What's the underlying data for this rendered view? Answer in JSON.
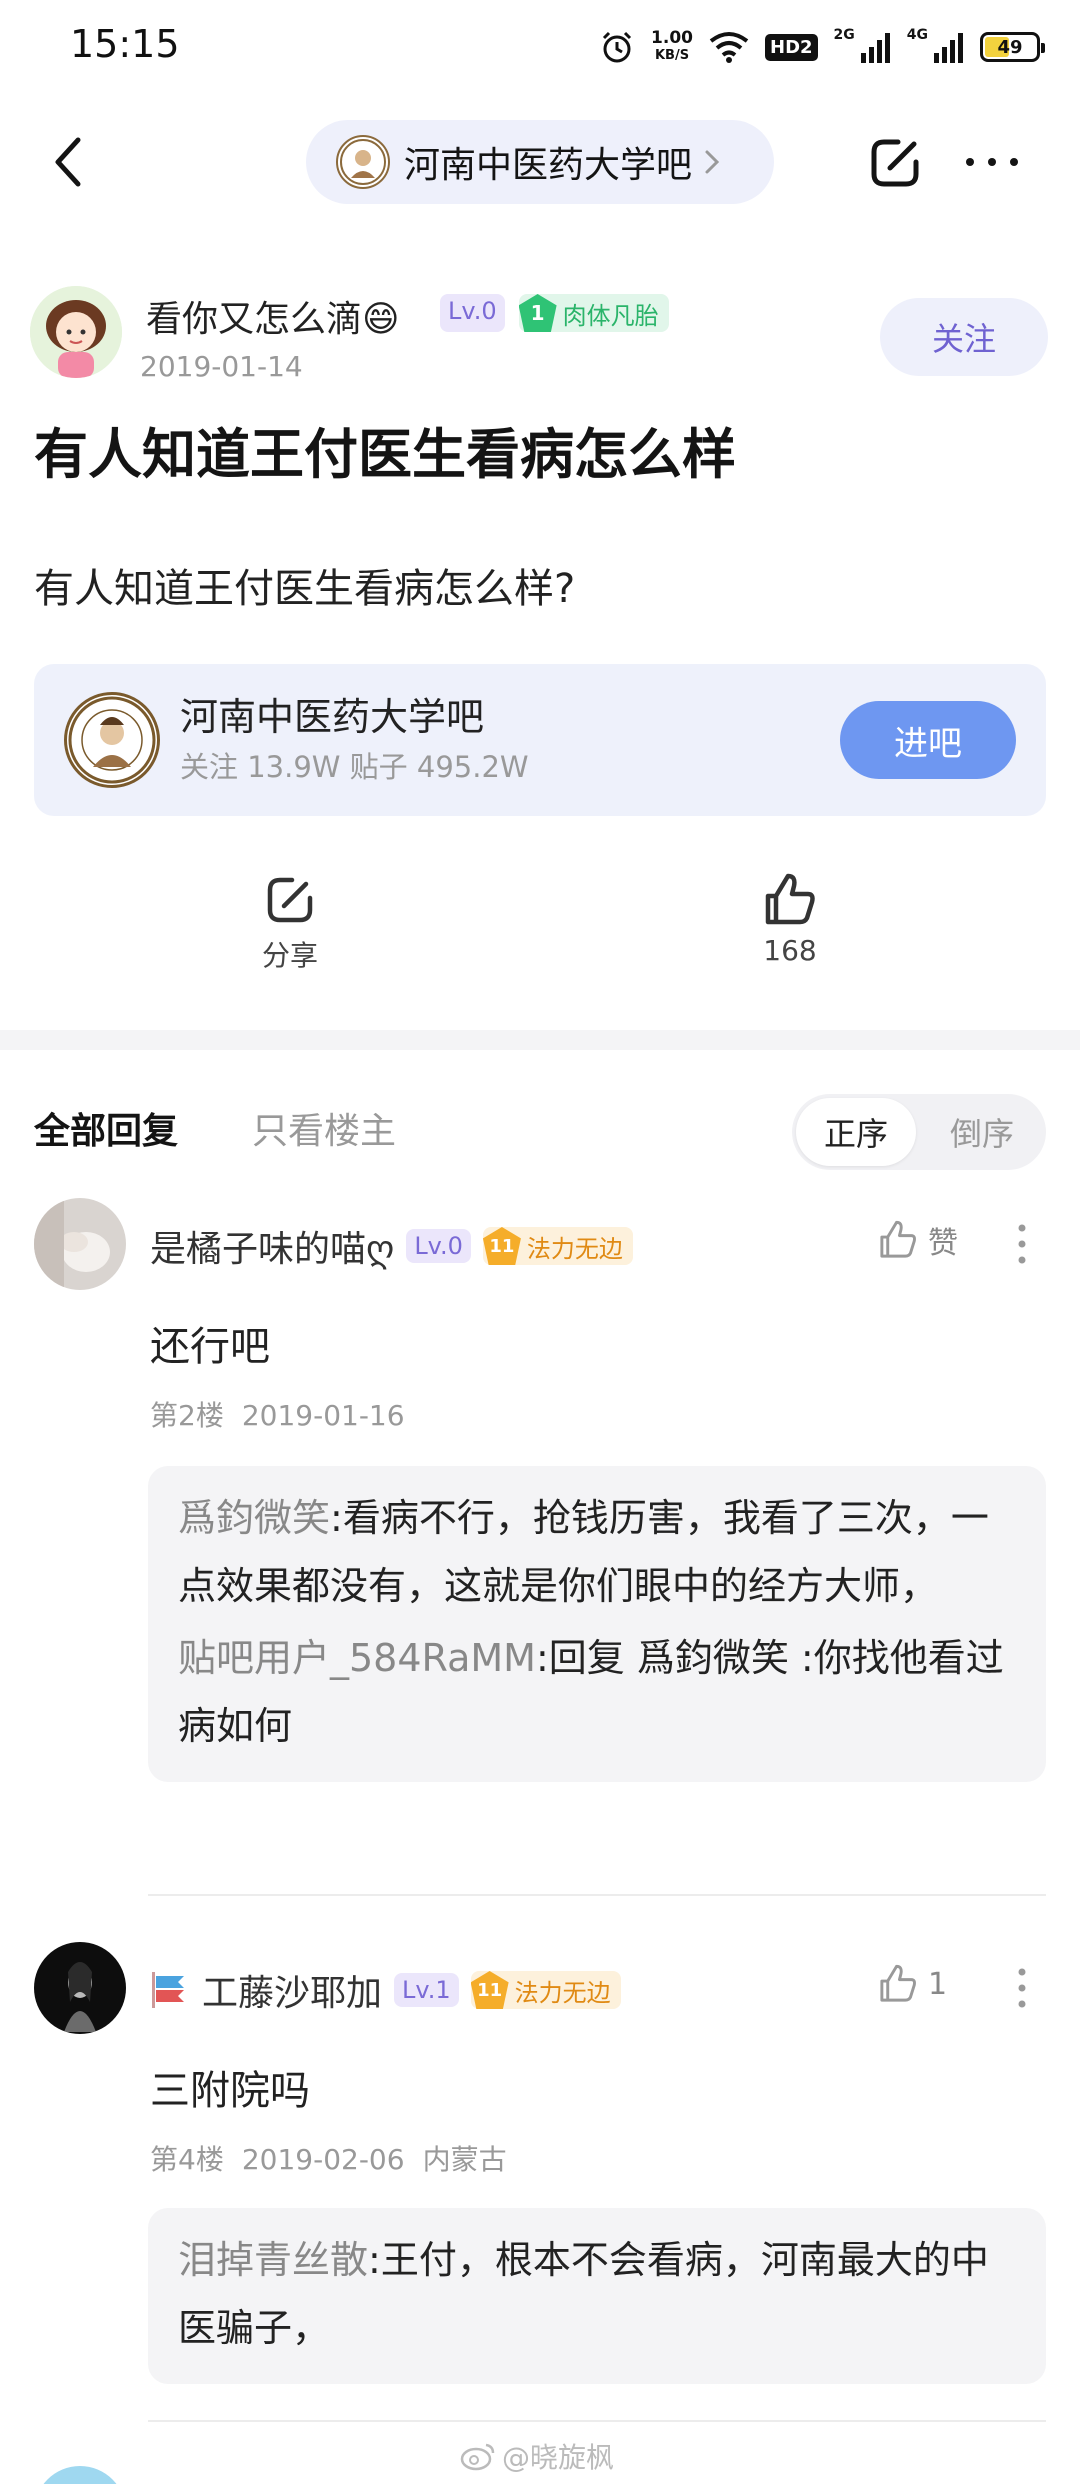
{
  "status_bar": {
    "time": "15:15",
    "net_speed_value": "1.00",
    "net_speed_unit": "KB/S",
    "hd_label": "HD2",
    "signal_1_label": "2G",
    "signal_2_label": "4G",
    "battery": "49"
  },
  "nav": {
    "forum_name": "河南中医药大学吧"
  },
  "post": {
    "author": "看你又怎么滴😄",
    "level": "Lv.0",
    "badge_level": "1",
    "badge_title": "肉体凡胎",
    "date": "2019-01-14",
    "follow_label": "关注",
    "title": "有人知道王付医生看病怎么样",
    "body": "有人知道王付医生看病怎么样?"
  },
  "forum_card": {
    "name": "河南中医药大学吧",
    "stats": "关注 13.9W   贴子 495.2W",
    "enter_label": "进吧"
  },
  "actions": {
    "share_label": "分享",
    "like_count": "168"
  },
  "reply_tabs": {
    "all": "全部回复",
    "owner_only": "只看楼主",
    "sort_asc": "正序",
    "sort_desc": "倒序"
  },
  "replies": [
    {
      "user": "是橘子味的喵ღ",
      "level": "Lv.0",
      "badge_level": "11",
      "badge_title": "法力无边",
      "like_label": "赞",
      "text": "还行吧",
      "floor": "第2楼",
      "date": "2019-01-16",
      "location": "",
      "sub_replies": [
        {
          "user": "爲鈞微笑",
          "text": ":看病不行，抢钱历害，我看了三次，一点效果都没有，这就是你们眼中的经方大师，"
        },
        {
          "user": "贴吧用户_584RaMM",
          "text": ":回复 爲鈞微笑 :你找他看过病如何"
        }
      ]
    },
    {
      "user": "工藤沙耶加",
      "level": "Lv.1",
      "badge_level": "11",
      "badge_title": "法力无边",
      "like_label": "1",
      "text": "三附院吗",
      "floor": "第4楼",
      "date": "2019-02-06",
      "location": "内蒙古",
      "sub_replies": [
        {
          "user": "泪掉青丝散",
          "text": ":王付，根本不会看病，河南最大的中医骗子，"
        }
      ]
    }
  ],
  "watermark": "@晓旋枫",
  "colors": {
    "accent_purple": "#6f62d1",
    "enter_blue": "#6e97f1",
    "level_green": "#2fc375",
    "level_gold": "#f5ad2a"
  }
}
